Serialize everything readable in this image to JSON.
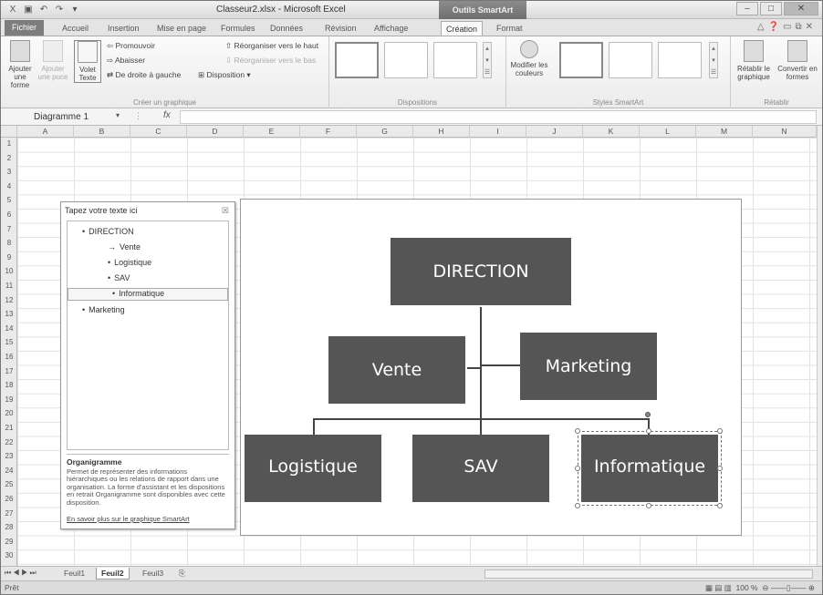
{
  "window": {
    "title": "Classeur2.xlsx - Microsoft Excel",
    "context_tab_title": "Outils SmartArt"
  },
  "tabs": [
    "Fichier",
    "Accueil",
    "Insertion",
    "Mise en page",
    "Formules",
    "Données",
    "Révision",
    "Affichage",
    "Création",
    "Format"
  ],
  "active_tab": "Création",
  "ribbon": {
    "create_group": {
      "label": "Créer un graphique",
      "add_shape": "Ajouter une forme",
      "add_bullet": "Ajouter une puce",
      "text_pane": "Volet Texte",
      "promote": "Promouvoir",
      "demote": "Abaisser",
      "right_to_left": "De droite à gauche",
      "move_up": "Réorganiser vers le haut",
      "move_down": "Réorganiser vers le bas",
      "layout": "Disposition"
    },
    "layouts_group": {
      "label": "Dispositions"
    },
    "styles_group": {
      "label": "Styles SmartArt",
      "change_colors": "Modifier les couleurs"
    },
    "reset_group": {
      "label": "Rétablir",
      "reset": "Rétablir le graphique",
      "convert": "Convertir en formes"
    }
  },
  "formula_bar": {
    "name_box": "Diagramme 1",
    "fx": "fx",
    "value": ""
  },
  "columns": [
    "A",
    "B",
    "C",
    "D",
    "E",
    "F",
    "G",
    "H",
    "I",
    "J",
    "K",
    "L",
    "M",
    "N"
  ],
  "rows": [
    "1",
    "2",
    "3",
    "4",
    "5",
    "6",
    "7",
    "8",
    "9",
    "10",
    "11",
    "12",
    "13",
    "14",
    "15",
    "16",
    "17",
    "18",
    "19",
    "20",
    "21",
    "22",
    "23",
    "24",
    "25",
    "26",
    "27",
    "28",
    "29",
    "30"
  ],
  "text_pane": {
    "title": "Tapez votre texte ici",
    "close": "☒",
    "items": [
      {
        "text": "DIRECTION",
        "bullet": "•",
        "level": 0
      },
      {
        "text": "Vente",
        "bullet": "→",
        "level": 1
      },
      {
        "text": "Logistique",
        "bullet": "•",
        "level": 1
      },
      {
        "text": "SAV",
        "bullet": "•",
        "level": 1
      },
      {
        "text": "Informatique",
        "bullet": "•",
        "level": 1
      },
      {
        "text": "Marketing",
        "bullet": "•",
        "level": 0
      }
    ],
    "description_title": "Organigramme",
    "description_body": "Permet de représenter des informations hiérarchiques ou les relations de rapport dans une organisation. La forme d'assistant et les dispositions en retrait Organigramme sont disponibles avec cette disposition.",
    "link": "En savoir plus sur le graphique SmartArt"
  },
  "smartart": {
    "top": "DIRECTION",
    "assistants": [
      "Vente",
      "Marketing"
    ],
    "children": [
      "Logistique",
      "SAV",
      "Informatique"
    ],
    "box_color": "#555555"
  },
  "sheets": [
    "Feuil1",
    "Feuil2",
    "Feuil3"
  ],
  "active_sheet": "Feuil2",
  "status": {
    "left": "Prêt",
    "zoom": "100 %"
  }
}
